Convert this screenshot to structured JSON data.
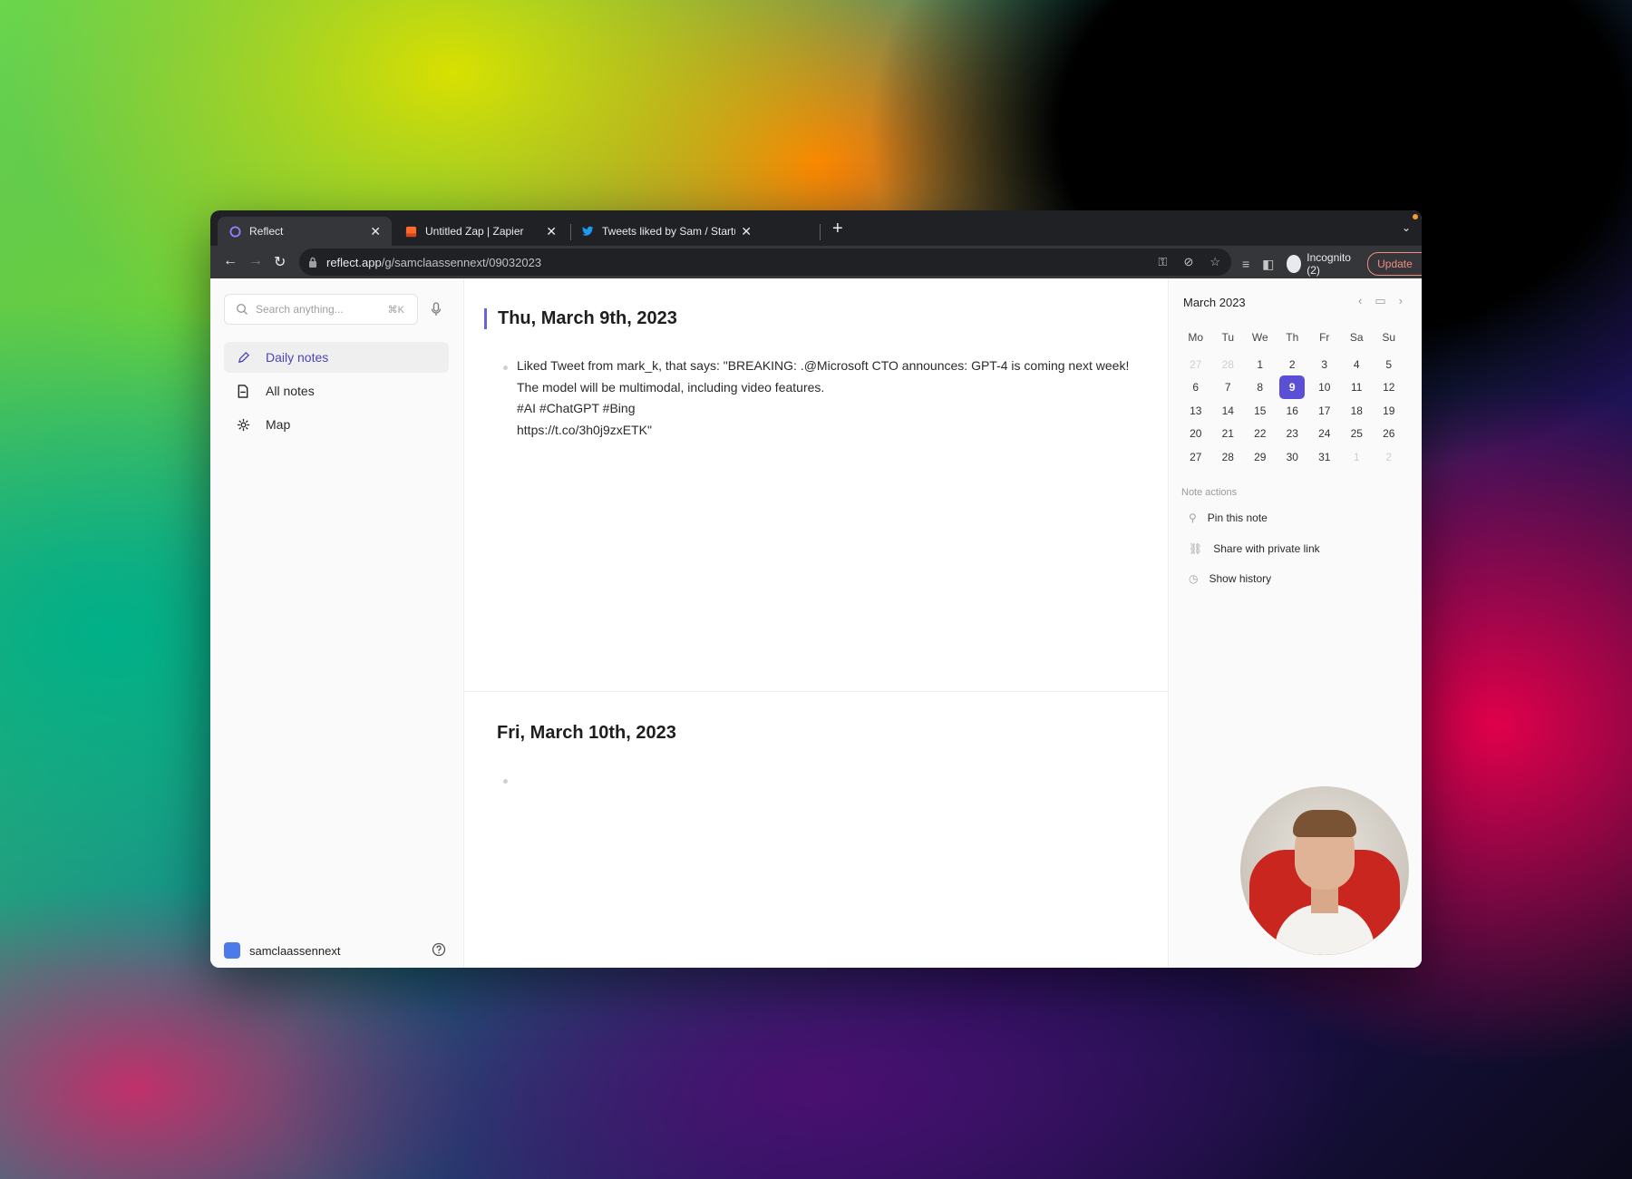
{
  "browser": {
    "tabs": [
      {
        "title": "Reflect",
        "active": true
      },
      {
        "title": "Untitled Zap | Zapier",
        "active": false
      },
      {
        "title": "Tweets liked by Sam / Startup (",
        "active": false
      }
    ],
    "url_host": "reflect.app",
    "url_path": "/g/samclaassennext/09032023",
    "profile_label": "Incognito (2)",
    "update_label": "Update",
    "accent_color": "#f28b82"
  },
  "sidebar": {
    "search_placeholder": "Search anything...",
    "search_shortcut": "⌘K",
    "items": [
      {
        "label": "Daily notes",
        "icon": "pencil-icon",
        "active": true
      },
      {
        "label": "All notes",
        "icon": "notes-icon",
        "active": false
      },
      {
        "label": "Map",
        "icon": "map-icon",
        "active": false
      }
    ],
    "user": "samclaassennext",
    "user_color": "#4b7be8"
  },
  "notes": [
    {
      "date": "Thu, March 9th, 2023",
      "lines": [
        "Liked Tweet from mark_k, that says: \"BREAKING: .@Microsoft CTO announces: GPT-4 is coming next week!",
        "The model will be multimodal, including video features.",
        "#AI #ChatGPT #Bing",
        "https://t.co/3h0j9zxETK\""
      ]
    },
    {
      "date": "Fri, March 10th, 2023",
      "lines": []
    }
  ],
  "calendar": {
    "month_label": "March 2023",
    "weekdays": [
      "Mo",
      "Tu",
      "We",
      "Th",
      "Fr",
      "Sa",
      "Su"
    ],
    "weeks": [
      [
        "27",
        "28",
        "1",
        "2",
        "3",
        "4",
        "5"
      ],
      [
        "6",
        "7",
        "8",
        "9",
        "10",
        "11",
        "12"
      ],
      [
        "13",
        "14",
        "15",
        "16",
        "17",
        "18",
        "19"
      ],
      [
        "20",
        "21",
        "22",
        "23",
        "24",
        "25",
        "26"
      ],
      [
        "27",
        "28",
        "29",
        "30",
        "31",
        "1",
        "2"
      ]
    ],
    "selected": "9",
    "accent_color": "#5b4fd6"
  },
  "note_actions": {
    "title": "Note actions",
    "items": [
      {
        "label": "Pin this note",
        "icon": "pin-icon"
      },
      {
        "label": "Share with private link",
        "icon": "link-icon"
      },
      {
        "label": "Show history",
        "icon": "clock-icon"
      }
    ]
  }
}
